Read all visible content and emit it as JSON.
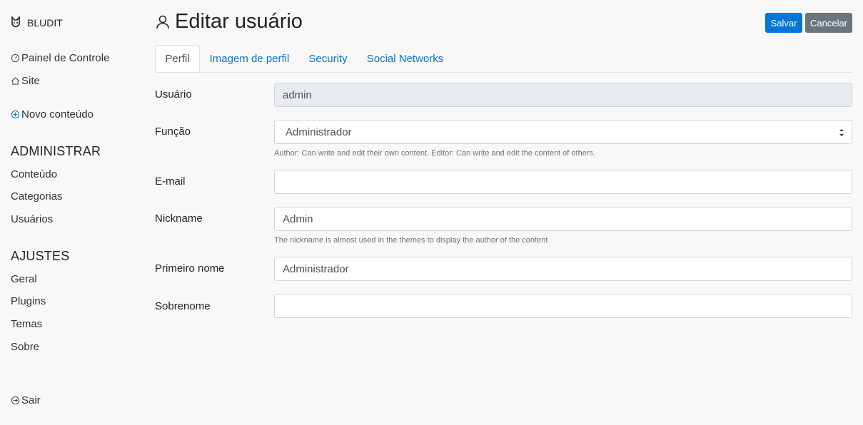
{
  "brand": {
    "name": "BLUDIT"
  },
  "sidebar": {
    "top_links": [
      {
        "label": "Painel de Controle",
        "icon": "dashboard-icon"
      },
      {
        "label": "Site",
        "icon": "home-icon"
      },
      {
        "label": "Novo conteúdo",
        "icon": "plus-circle-icon"
      }
    ],
    "sections": [
      {
        "title": "ADMINISTRAR",
        "items": [
          "Conteúdo",
          "Categorias",
          "Usuários"
        ]
      },
      {
        "title": "AJUSTES",
        "items": [
          "Geral",
          "Plugins",
          "Temas",
          "Sobre"
        ]
      }
    ],
    "logout": {
      "label": "Sair",
      "icon": "logout-icon"
    }
  },
  "header": {
    "title": "Editar usuário",
    "icon": "user-icon"
  },
  "actions": {
    "save": "Salvar",
    "cancel": "Cancelar"
  },
  "tabs": [
    "Perfil",
    "Imagem de perfil",
    "Security",
    "Social Networks"
  ],
  "form": {
    "username": {
      "label": "Usuário",
      "value": "admin"
    },
    "role": {
      "label": "Função",
      "value": "Administrador",
      "help": "Author: Can write and edit their own content. Editor: Can write and edit the content of others."
    },
    "email": {
      "label": "E-mail",
      "value": ""
    },
    "nickname": {
      "label": "Nickname",
      "value": "Admin",
      "help": "The nickname is almost used in the themes to display the author of the content"
    },
    "first_name": {
      "label": "Primeiro nome",
      "value": "Administrador"
    },
    "last_name": {
      "label": "Sobrenome",
      "value": ""
    }
  },
  "colors": {
    "primary": "#0275d8",
    "secondary": "#6c757d",
    "background": "#f8f8f8"
  }
}
